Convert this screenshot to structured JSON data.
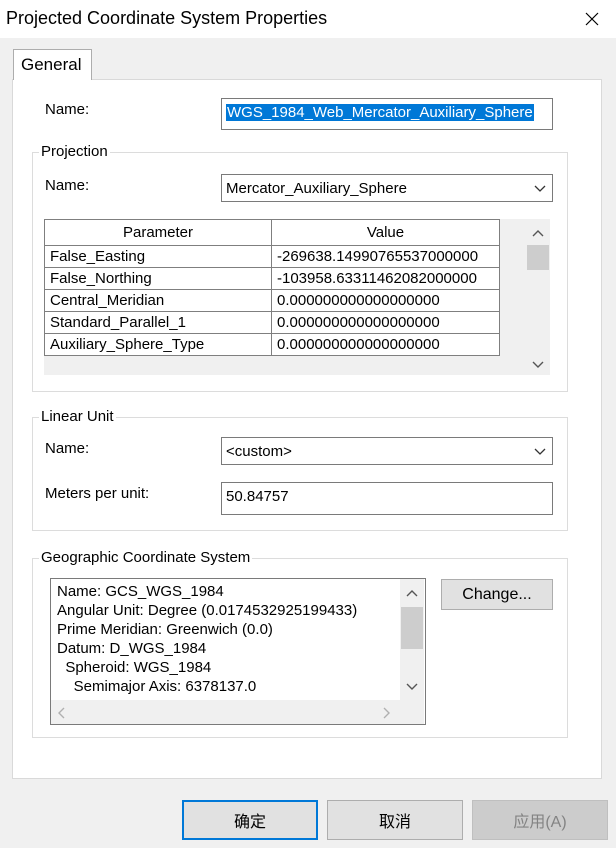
{
  "window": {
    "title": "Projected Coordinate System Properties"
  },
  "tabs": [
    {
      "label": "General"
    }
  ],
  "name_label": "Name:",
  "name_value": "WGS_1984_Web_Mercator_Auxiliary_Sphere",
  "projection": {
    "group_title": "Projection",
    "name_label": "Name:",
    "name_value": "Mercator_Auxiliary_Sphere",
    "columns": [
      "Parameter",
      "Value"
    ],
    "rows": [
      {
        "parameter": "False_Easting",
        "value": "-269638.14990765537000000"
      },
      {
        "parameter": "False_Northing",
        "value": "-103958.63311462082000000"
      },
      {
        "parameter": "Central_Meridian",
        "value": "0.000000000000000000"
      },
      {
        "parameter": "Standard_Parallel_1",
        "value": "0.000000000000000000"
      },
      {
        "parameter": "Auxiliary_Sphere_Type",
        "value": "0.000000000000000000"
      }
    ]
  },
  "linear_unit": {
    "group_title": "Linear Unit",
    "name_label": "Name:",
    "name_value": "<custom>",
    "meters_label": "Meters per unit:",
    "meters_value": "50.84757"
  },
  "gcs": {
    "group_title": "Geographic Coordinate System",
    "lines": [
      "Name: GCS_WGS_1984",
      "Angular Unit: Degree (0.0174532925199433)",
      "Prime Meridian: Greenwich (0.0)",
      "Datum: D_WGS_1984",
      "  Spheroid: WGS_1984",
      "    Semimajor Axis: 6378137.0"
    ],
    "change_label": "Change..."
  },
  "footer": {
    "ok_label": "确定",
    "cancel_label": "取消",
    "apply_label": "应用(A)"
  },
  "icons": {
    "close": "close-icon",
    "dropdown": "chevron-down-icon",
    "scroll_up": "chevron-up-icon",
    "scroll_down": "chevron-down-icon",
    "scroll_left": "chevron-left-icon",
    "scroll_right": "chevron-right-icon"
  },
  "colors": {
    "selection": "#0078d7",
    "default_button_border": "#0078d7"
  }
}
